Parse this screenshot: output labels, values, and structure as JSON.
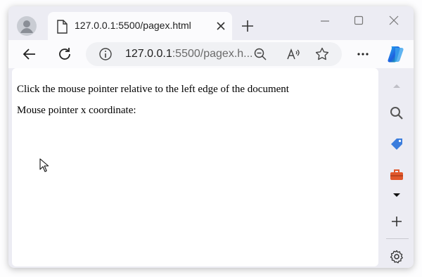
{
  "tab": {
    "title": "127.0.0.1:5500/pagex.html"
  },
  "address_bar": {
    "host": "127.0.0.1",
    "path": ":5500/pagex.h..."
  },
  "page": {
    "instruction": "Click the mouse pointer relative to the left edge of the document",
    "coordinate_label": "Mouse pointer x coordinate:"
  },
  "icons": [
    "profile-icon",
    "document-icon",
    "close-icon",
    "plus-icon",
    "minimize-icon",
    "maximize-icon",
    "close-window-icon",
    "back-arrow-icon",
    "refresh-icon",
    "info-icon",
    "zoom-out-icon",
    "read-aloud-icon",
    "favorite-star-icon",
    "more-icon",
    "copilot-icon",
    "search-icon",
    "shopping-tag-icon",
    "tools-icon",
    "caret-down-icon",
    "add-icon",
    "settings-gear-icon",
    "mouse-cursor-icon"
  ],
  "colors": {
    "frame": "#ececf3",
    "tab_bg": "#fbfbfd",
    "copilot_blue": "#1e88e5",
    "tag_blue": "#3b7ddd",
    "toolbox_orange": "#e0572b"
  }
}
